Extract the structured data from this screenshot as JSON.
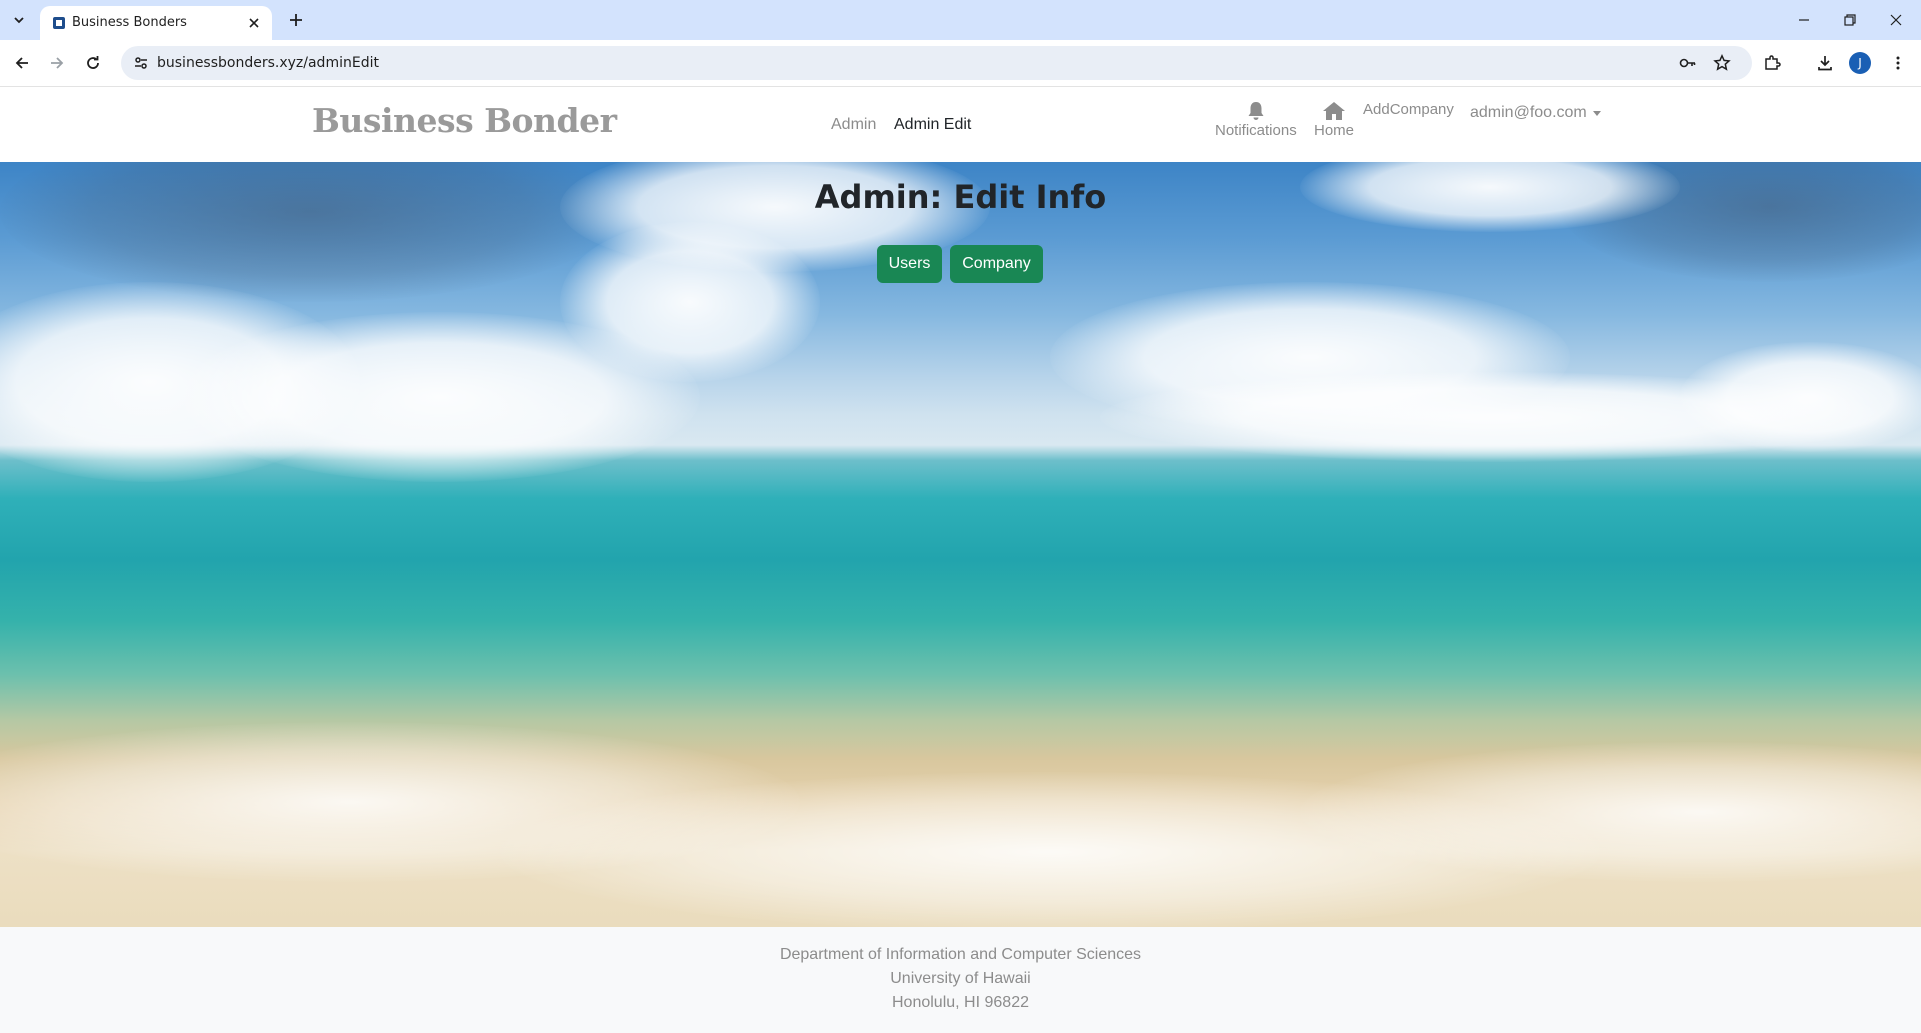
{
  "browser": {
    "tab_title": "Business Bonders",
    "url": "businessbonders.xyz/adminEdit",
    "profile_initial": "J"
  },
  "navbar": {
    "brand": "Business Bonder",
    "links": {
      "admin": "Admin",
      "admin_edit": "Admin Edit"
    },
    "notifications_label": "Notifications",
    "home_label": "Home",
    "add_company_label": "AddCompany",
    "user_email": "admin@foo.com"
  },
  "hero": {
    "title": "Admin: Edit Info",
    "users_button": "Users",
    "company_button": "Company"
  },
  "footer": {
    "line1": "Department of Information and Computer Sciences",
    "line2": "University of Hawaii",
    "line3": "Honolulu, HI 96822"
  },
  "colors": {
    "accent_green": "#198754",
    "muted_text": "#8c8c8c"
  }
}
